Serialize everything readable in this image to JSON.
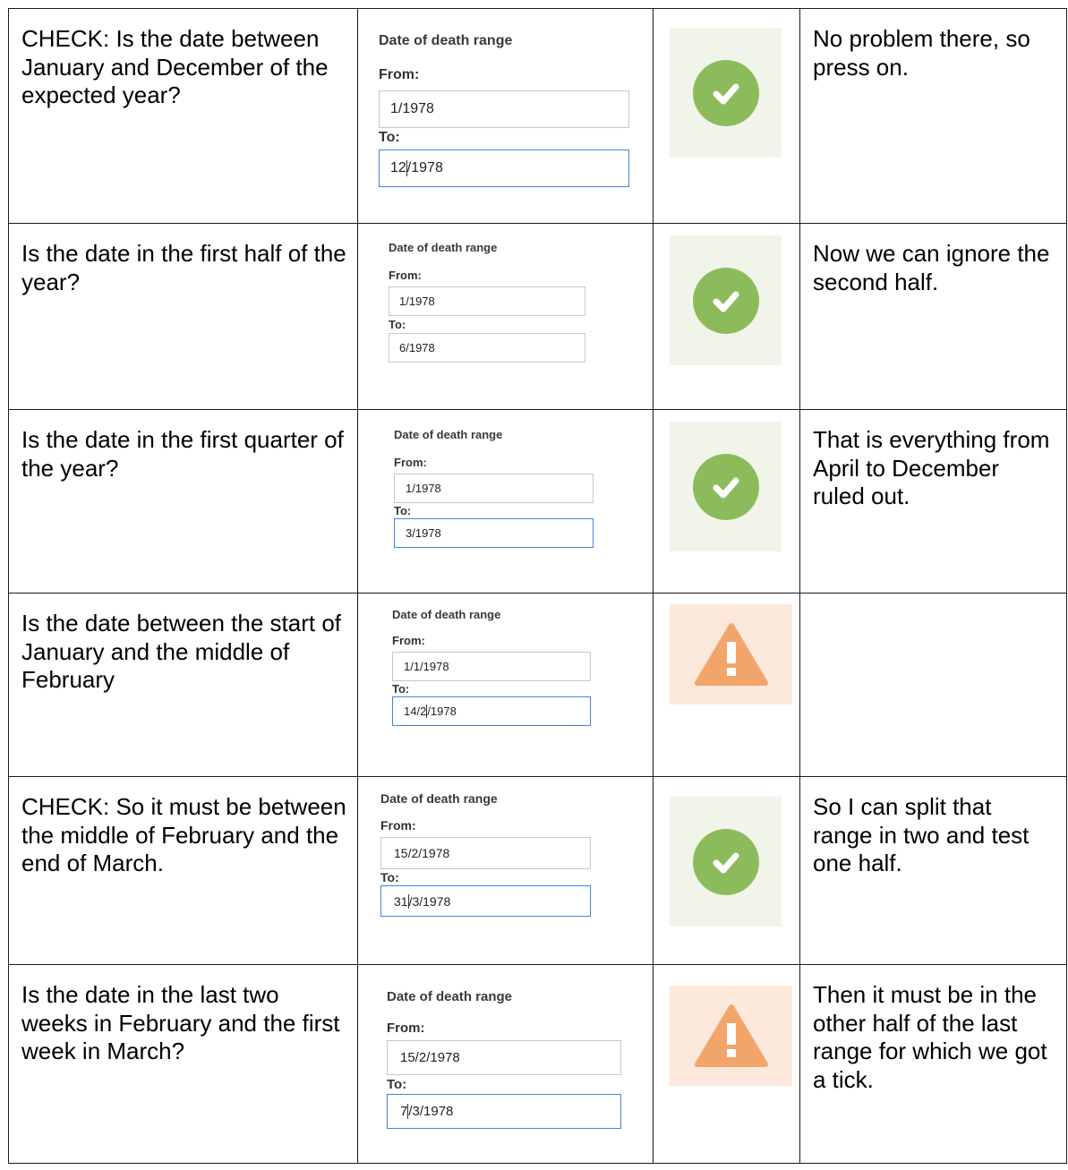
{
  "form_title": "Date of death range",
  "from_label": "From:",
  "to_label": "To:",
  "colors": {
    "ok_tile": "#f1f5e9",
    "ok_icon": "#8cbb5c",
    "warn_tile": "#fde9dc",
    "warn_icon": "#f2a56b",
    "active_border": "#3f86d8"
  },
  "rows": [
    {
      "question": "CHECK: Is the date between January and December of the expected year?",
      "from": "1/1978",
      "to_before": "12",
      "to_after": "/1978",
      "to_active": true,
      "icon": "check-circle-icon",
      "note": "No problem there, so press on."
    },
    {
      "question": "Is the date in the first half of the year?",
      "from": "1/1978",
      "to_before": "6/1978",
      "to_after": "",
      "to_active": false,
      "icon": "check-circle-icon",
      "note": "Now we can ignore the second half."
    },
    {
      "question": "Is the date in the first quarter of the year?",
      "from": "1/1978",
      "to_before": "3/1978",
      "to_after": "",
      "to_active": true,
      "icon": "check-circle-icon",
      "note": "That is everything from April to December ruled out."
    },
    {
      "question": "Is the date between the start of January and the middle of February",
      "from": "1/1/1978",
      "to_before": "14/2",
      "to_after": "/1978",
      "to_active": true,
      "icon": "warning-triangle-icon",
      "note": ""
    },
    {
      "question": "CHECK: So it must be between the middle of February and the end of March.",
      "from": "15/2/1978",
      "to_before": "31",
      "to_after": "/3/1978",
      "to_active": true,
      "icon": "check-circle-icon",
      "note": "So I can split that range in two and test one half."
    },
    {
      "question": "Is the date in the last two weeks in February and the first week in March?",
      "from": "15/2/1978",
      "to_before": "7",
      "to_after": "/3/1978",
      "to_active": true,
      "icon": "warning-triangle-icon",
      "note": "Then it must be in the other half of the last range for which we got a tick."
    }
  ]
}
